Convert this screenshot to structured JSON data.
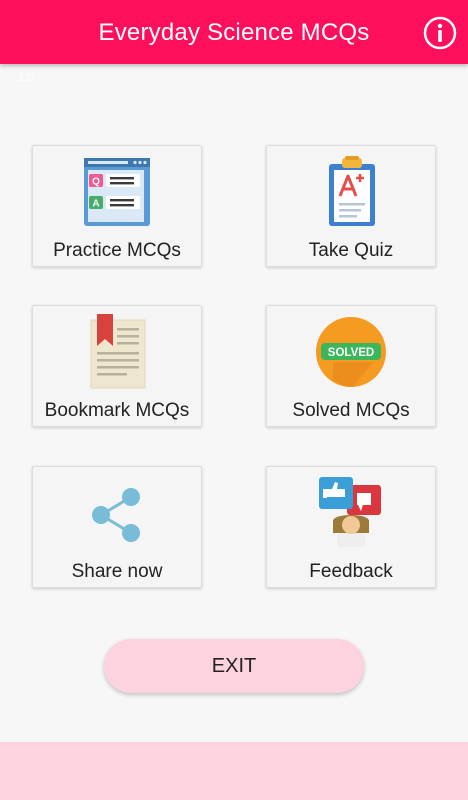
{
  "app": {
    "title": "Everyday Science MCQs",
    "status_mark": "1.0"
  },
  "colors": {
    "appbar": "#fd0f5b",
    "background": "#f7f7f7",
    "exit_button": "#fcd3df",
    "bottom_bar": "#fcd3df"
  },
  "menu": {
    "practice": {
      "label": "Practice MCQs",
      "icon": "qa-window-icon"
    },
    "quiz": {
      "label": "Take Quiz",
      "icon": "clipboard-grade-icon"
    },
    "bookmark": {
      "label": "Bookmark MCQs",
      "icon": "bookmark-page-icon"
    },
    "solved": {
      "label": "Solved MCQs",
      "icon": "solved-badge-icon",
      "badge_text": "SOLVED"
    },
    "share": {
      "label": "Share now",
      "icon": "share-icon"
    },
    "feedback": {
      "label": "Feedback",
      "icon": "thumbs-feedback-icon"
    }
  },
  "exit": {
    "label": "EXIT"
  },
  "icon_text": {
    "q": "Q",
    "a": "A"
  }
}
